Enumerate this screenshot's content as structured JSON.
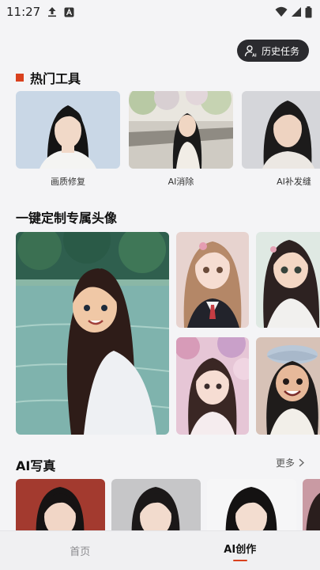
{
  "status_bar": {
    "time": "11:27"
  },
  "header": {
    "history_label": "历史任务"
  },
  "tools_section": {
    "title": "热门工具",
    "items": [
      {
        "label": "画质修复"
      },
      {
        "label": "AI消除"
      },
      {
        "label": "AI补发缝"
      }
    ]
  },
  "avatar_section": {
    "title": "一键定制专属头像"
  },
  "photo_section": {
    "title": "AI写真",
    "more_label": "更多"
  },
  "tabs": [
    {
      "label": "首页"
    },
    {
      "label": "AI创作"
    }
  ],
  "colors": {
    "accent": "#d9411e",
    "dark_button": "#2b2b2f",
    "background": "#f4f4f6"
  }
}
